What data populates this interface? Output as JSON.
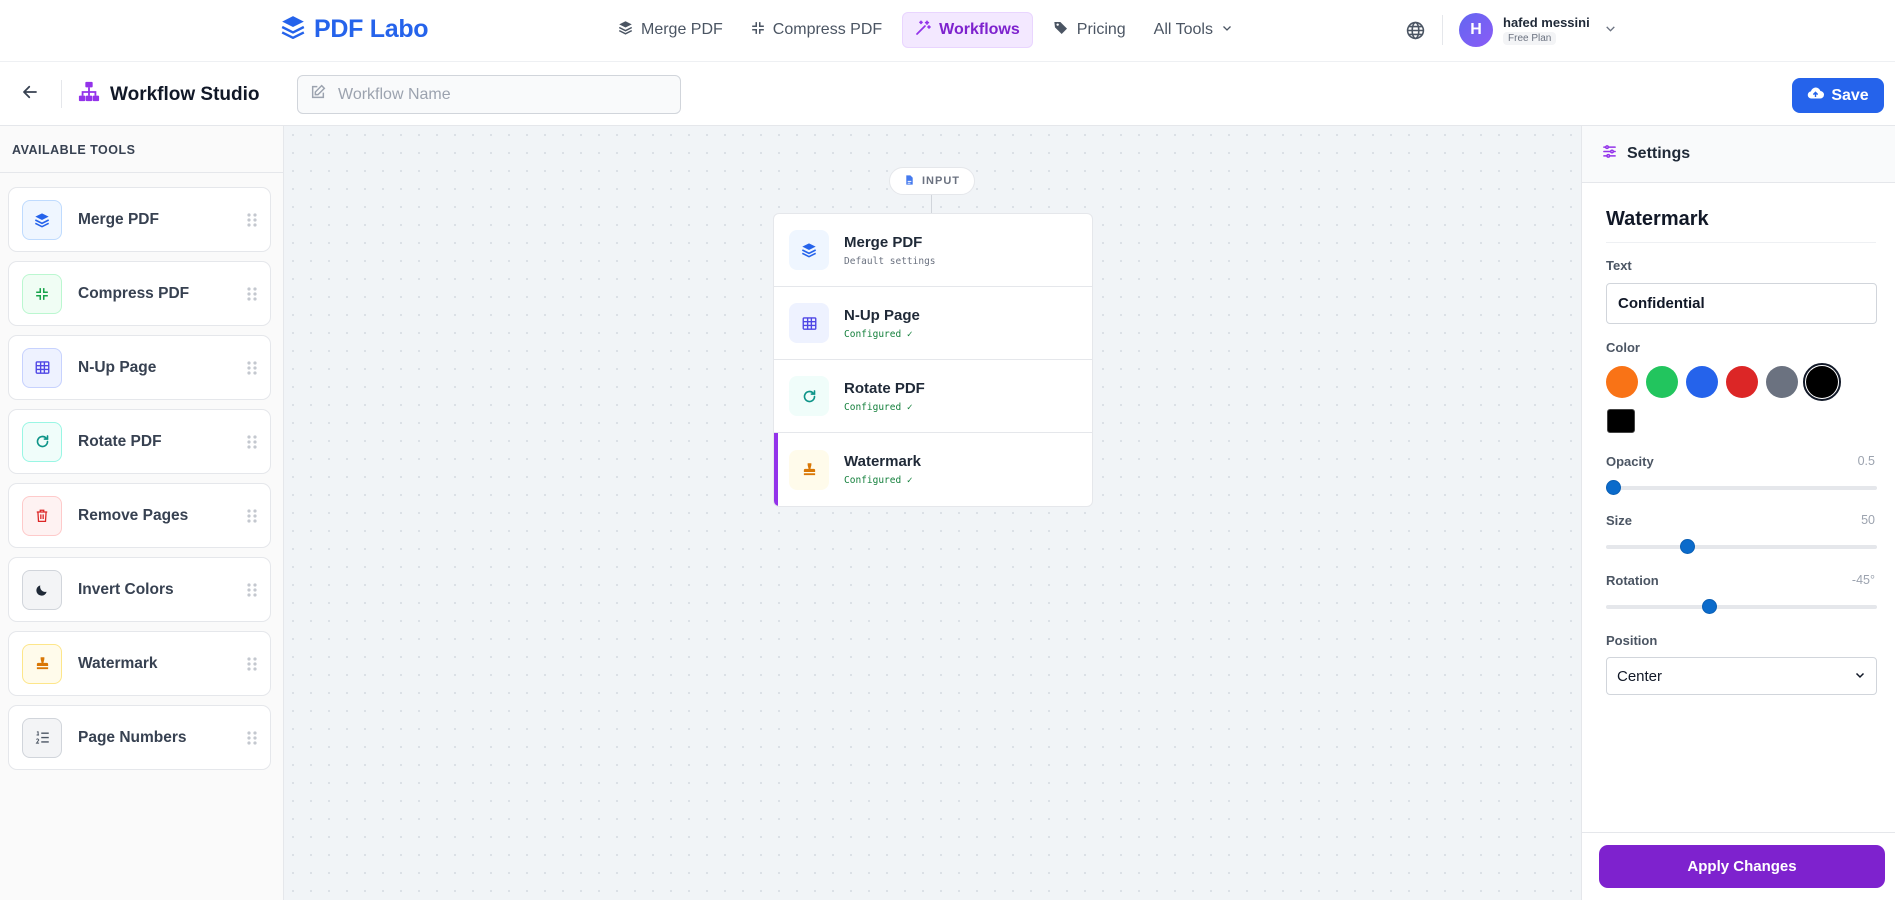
{
  "brand": {
    "name": "PDF Labo",
    "color": "#2563eb"
  },
  "nav": {
    "links": [
      {
        "label": "Merge PDF",
        "icon": "layers-icon"
      },
      {
        "label": "Compress PDF",
        "icon": "compress-icon"
      },
      {
        "label": "Workflows",
        "icon": "magic-wand-icon",
        "active": true
      },
      {
        "label": "Pricing",
        "icon": "tags-icon"
      },
      {
        "label": "All Tools",
        "icon": "chevron-down-icon"
      }
    ],
    "user": {
      "initial": "H",
      "name": "hafed messini",
      "plan": "Free Plan"
    }
  },
  "studio": {
    "title": "Workflow Studio",
    "workflow_name_placeholder": "Workflow Name",
    "workflow_name_value": "",
    "save_label": "Save"
  },
  "sidebar": {
    "heading": "AVAILABLE TOOLS",
    "tools": [
      {
        "label": "Merge PDF",
        "icon": "layers-icon",
        "color": "#2563eb"
      },
      {
        "label": "Compress PDF",
        "icon": "compress-icon",
        "color": "#16a34a"
      },
      {
        "label": "N-Up Page",
        "icon": "grid-icon",
        "color": "#4f46e5"
      },
      {
        "label": "Rotate PDF",
        "icon": "rotate-icon",
        "color": "#0d9488"
      },
      {
        "label": "Remove Pages",
        "icon": "trash-icon",
        "color": "#dc2626"
      },
      {
        "label": "Invert Colors",
        "icon": "moon-icon",
        "color": "#374151"
      },
      {
        "label": "Watermark",
        "icon": "stamp-icon",
        "color": "#d97706"
      },
      {
        "label": "Page Numbers",
        "icon": "list-numbered-icon",
        "color": "#4b5563"
      }
    ]
  },
  "canvas": {
    "input_label": "INPUT",
    "steps": [
      {
        "title": "Merge PDF",
        "status": "Default settings",
        "configured": false
      },
      {
        "title": "N-Up Page",
        "status": "Configured ✓",
        "configured": true
      },
      {
        "title": "Rotate PDF",
        "status": "Configured ✓",
        "configured": true
      },
      {
        "title": "Watermark",
        "status": "Configured ✓",
        "configured": true,
        "selected": true
      }
    ]
  },
  "settings": {
    "heading": "Settings",
    "tool_title": "Watermark",
    "text_label": "Text",
    "text_value": "Confidential",
    "color_label": "Color",
    "colors": [
      "#f97316",
      "#22c55e",
      "#2563eb",
      "#dc2626",
      "#6b7280",
      "#000000"
    ],
    "selected_color": "#000000",
    "custom_color": "#000000",
    "opacity_label": "Opacity",
    "opacity_value": "0.5",
    "opacity_fraction": 0.0,
    "size_label": "Size",
    "size_value": "50",
    "size_fraction": 0.3,
    "rotation_label": "Rotation",
    "rotation_value": "-45°",
    "rotation_fraction": 0.38,
    "position_label": "Position",
    "position_value": "Center",
    "apply_label": "Apply Changes",
    "accent": "#7e22ce"
  }
}
